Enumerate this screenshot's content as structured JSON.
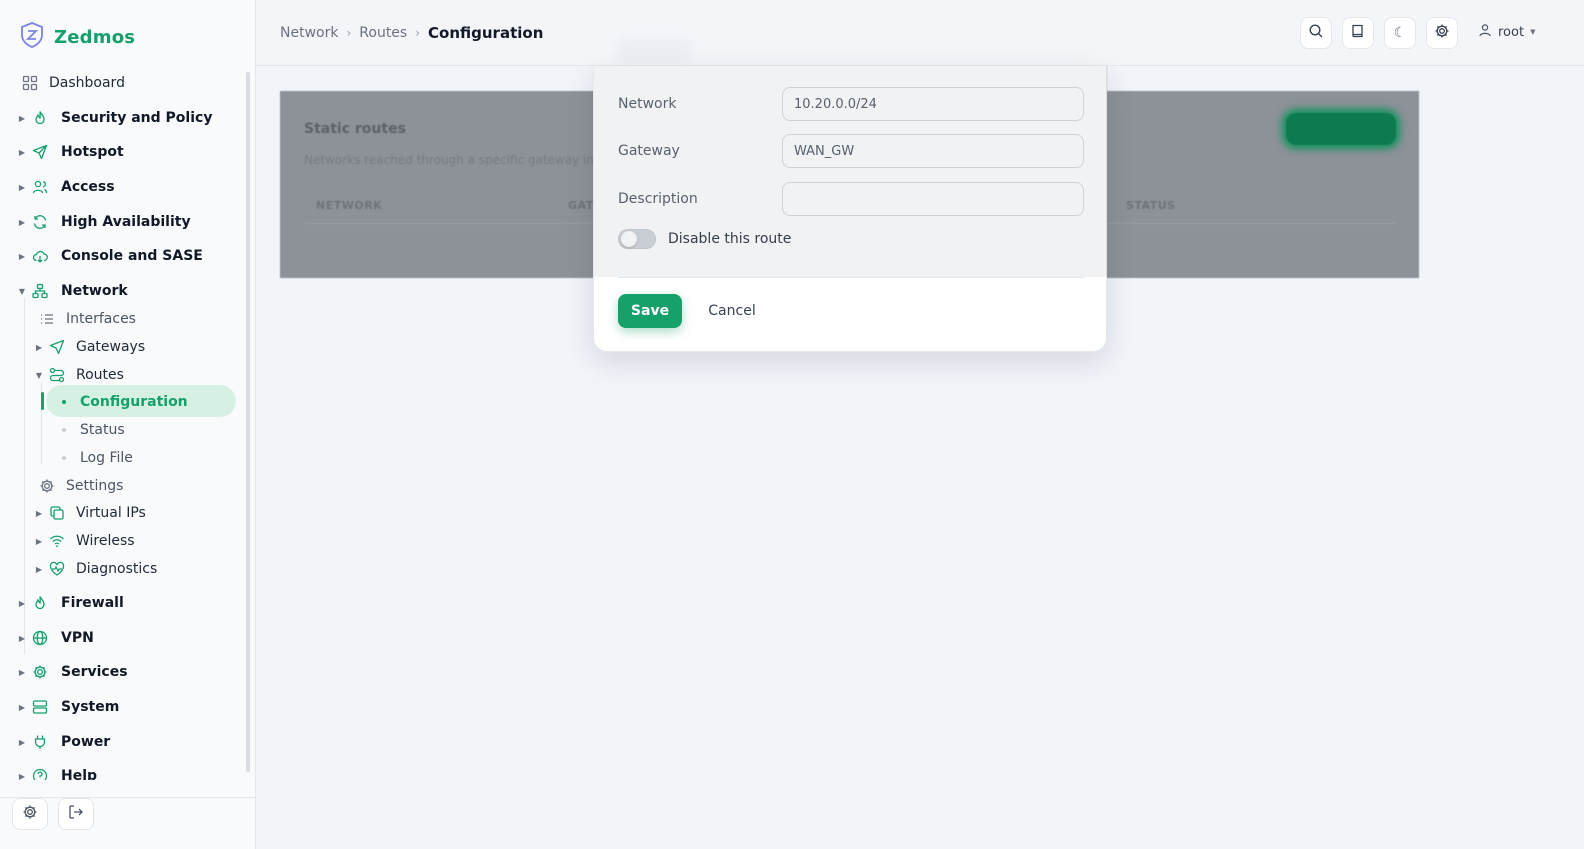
{
  "app": {
    "brand": "Zedmos",
    "accent": "#16a06a"
  },
  "breadcrumb": {
    "items": [
      "Network",
      "Routes"
    ],
    "current": "Configuration"
  },
  "header": {
    "user": "root"
  },
  "sidebar": {
    "dashboard": "Dashboard",
    "top_groups": [
      {
        "label": "Security and Policy",
        "icon": "flame-icon"
      },
      {
        "label": "Hotspot",
        "icon": "send-icon"
      },
      {
        "label": "Access",
        "icon": "users-icon"
      },
      {
        "label": "High Availability",
        "icon": "refresh-icon"
      },
      {
        "label": "Console and SASE",
        "icon": "cloud-icon"
      }
    ],
    "network": {
      "label": "Network",
      "children": {
        "interfaces": "Interfaces",
        "gateways": "Gateways",
        "routes": "Routes",
        "routes_children": [
          "Configuration",
          "Status",
          "Log File"
        ],
        "settings": "Settings",
        "virtual_ips": "Virtual IPs",
        "wireless": "Wireless",
        "diagnostics": "Diagnostics"
      }
    },
    "bottom_groups": [
      {
        "label": "Firewall",
        "icon": "flame-icon"
      },
      {
        "label": "VPN",
        "icon": "globe-icon"
      },
      {
        "label": "Services",
        "icon": "gear-icon"
      },
      {
        "label": "System",
        "icon": "server-icon"
      },
      {
        "label": "Power",
        "icon": "plug-icon"
      },
      {
        "label": "Help",
        "icon": "help-icon"
      }
    ]
  },
  "background_card": {
    "title": "Static routes",
    "subtitle": "Networks reached through a specific gateway ins",
    "columns": [
      "NETWORK",
      "GAT",
      "STATUS"
    ]
  },
  "modal": {
    "fields": {
      "network": {
        "label": "Network",
        "value": "10.20.0.0/24"
      },
      "gateway": {
        "label": "Gateway",
        "value": "WAN_GW"
      },
      "description": {
        "label": "Description",
        "value": ""
      }
    },
    "toggle": {
      "label": "Disable this route",
      "on": false
    },
    "save_label": "Save",
    "cancel_label": "Cancel"
  }
}
